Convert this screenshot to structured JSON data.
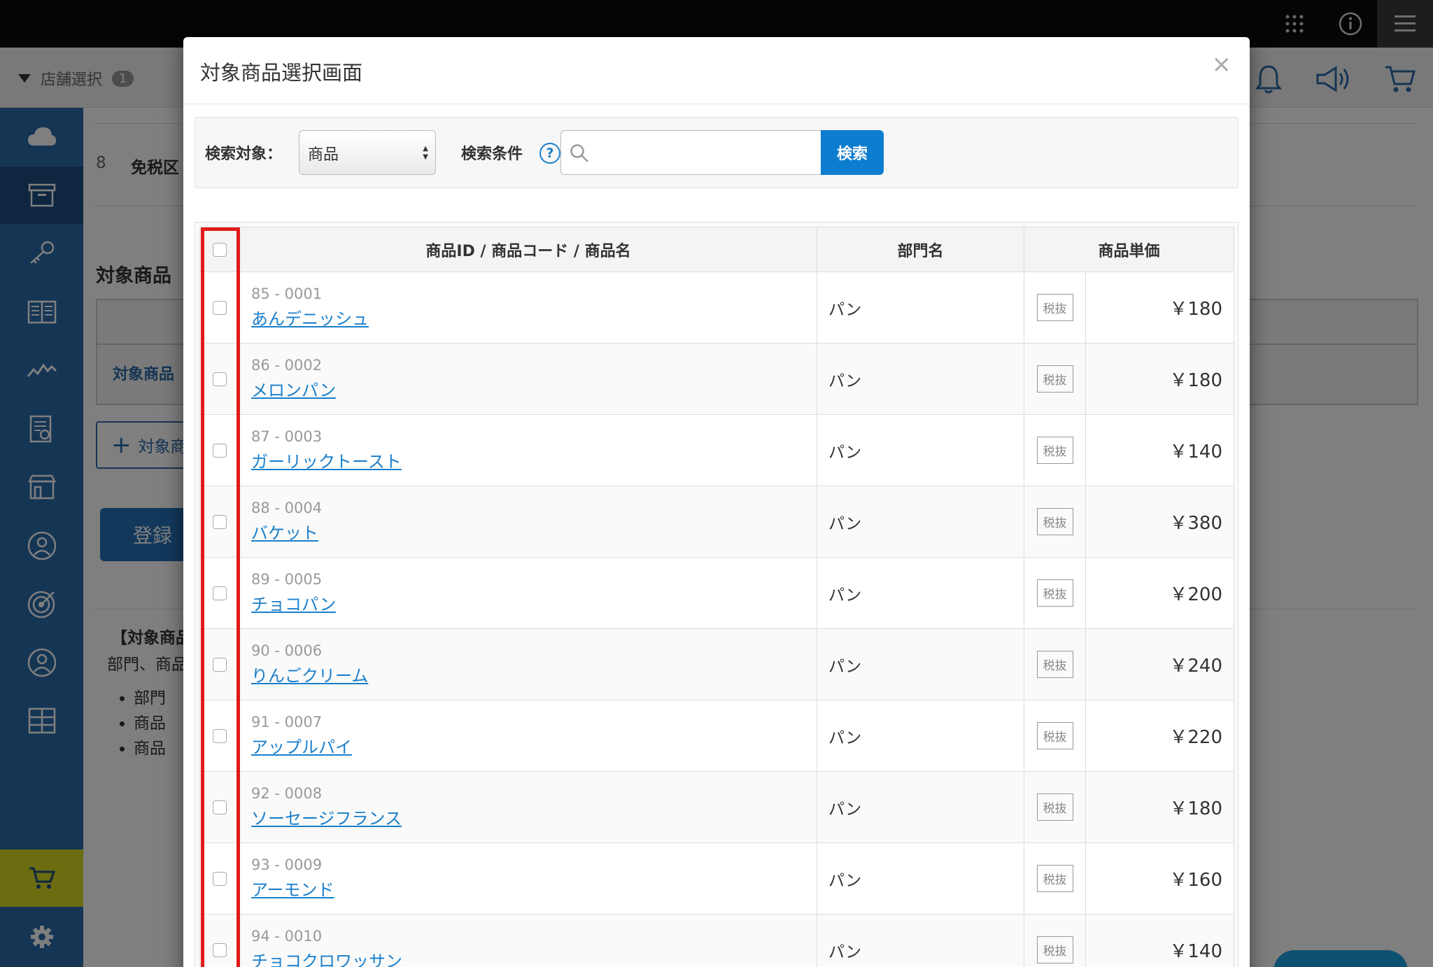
{
  "app": {
    "store_selector": {
      "label": "店舗選択",
      "count": "1"
    },
    "main": {
      "row_number": "8",
      "tax_label": "免税区",
      "section_title": "対象商品",
      "table_link": "対象商品",
      "add_button_label": "対象商",
      "register_button_label": "登録",
      "note_title": "【対象商品",
      "note_text": "部門、商品",
      "bullets": [
        "部門",
        "商品",
        "商品"
      ]
    }
  },
  "modal": {
    "title": "対象商品選択画面",
    "close_label": "×",
    "search": {
      "target_label": "検索対象：",
      "target_value": "商品",
      "condition_label": "検索条件",
      "help_label": "?",
      "placeholder": "",
      "button_label": "検索"
    },
    "table": {
      "headers": {
        "product": "商品ID / 商品コード / 商品名",
        "department": "部門名",
        "price": "商品単価"
      },
      "rows": [
        {
          "id": "85 - 0001",
          "name": "あんデニッシュ",
          "dept": "パン",
          "tax": "税抜",
          "price": "￥180"
        },
        {
          "id": "86 - 0002",
          "name": "メロンパン",
          "dept": "パン",
          "tax": "税抜",
          "price": "￥180"
        },
        {
          "id": "87 - 0003",
          "name": "ガーリックトースト",
          "dept": "パン",
          "tax": "税抜",
          "price": "￥140"
        },
        {
          "id": "88 - 0004",
          "name": "バケット",
          "dept": "パン",
          "tax": "税抜",
          "price": "￥380"
        },
        {
          "id": "89 - 0005",
          "name": "チョコパン",
          "dept": "パン",
          "tax": "税抜",
          "price": "￥200"
        },
        {
          "id": "90 - 0006",
          "name": "りんごクリーム",
          "dept": "パン",
          "tax": "税抜",
          "price": "￥240"
        },
        {
          "id": "91 - 0007",
          "name": "アップルパイ",
          "dept": "パン",
          "tax": "税抜",
          "price": "￥220"
        },
        {
          "id": "92 - 0008",
          "name": "ソーセージフランス",
          "dept": "パン",
          "tax": "税抜",
          "price": "￥180"
        },
        {
          "id": "93 - 0009",
          "name": "アーモンド",
          "dept": "パン",
          "tax": "税抜",
          "price": "￥160"
        },
        {
          "id": "94 - 0010",
          "name": "チョコクロワッサン",
          "dept": "パン",
          "tax": "税抜",
          "price": "￥140"
        }
      ]
    }
  },
  "colors": {
    "sidebar": "#2b6aa9",
    "highlight": "#e21a1a",
    "link": "#1b7fcb",
    "search_button": "#0d7dd0"
  }
}
